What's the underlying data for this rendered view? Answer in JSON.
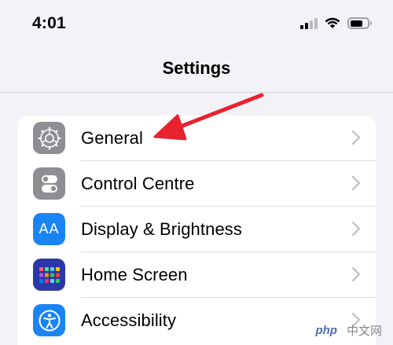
{
  "status_bar": {
    "time": "4:01",
    "signal_icon": "cellular-signal-icon",
    "wifi_icon": "wifi-icon",
    "battery_icon": "battery-icon",
    "battery_level": 0.75
  },
  "nav": {
    "title": "Settings"
  },
  "settings_rows": [
    {
      "label": "General",
      "icon": "gear-icon",
      "icon_bg": "#8e8e93"
    },
    {
      "label": "Control Centre",
      "icon": "toggles-icon",
      "icon_bg": "#8e8e93"
    },
    {
      "label": "Display & Brightness",
      "icon": "text-size-icon",
      "icon_bg": "#1a84f5"
    },
    {
      "label": "Home Screen",
      "icon": "app-grid-icon",
      "icon_bg": "#2c38a8"
    },
    {
      "label": "Accessibility",
      "icon": "accessibility-icon",
      "icon_bg": "#1a84f5"
    }
  ],
  "icon_glyph_text": "AA",
  "annotation": {
    "arrow_color": "#e8222e",
    "points_to": "General"
  },
  "watermark": {
    "badge": "php",
    "text": "中文网"
  }
}
